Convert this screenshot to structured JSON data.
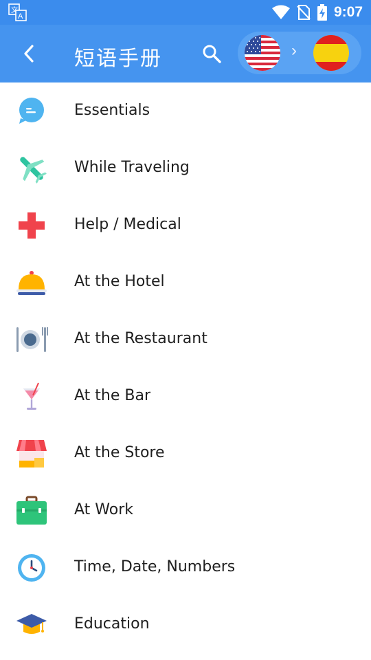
{
  "status_bar": {
    "time": "9:07",
    "icons": [
      "translate-icon",
      "wifi-icon",
      "no-sim-icon",
      "battery-charging-icon"
    ]
  },
  "app_bar": {
    "title": "短语手册",
    "back_icon": "back-arrow-icon",
    "search_icon": "search-icon",
    "source_language_flag": "us-flag",
    "target_language_flag": "spain-flag",
    "arrow": "›"
  },
  "categories": [
    {
      "label": "Essentials",
      "icon": "speech-bubble-icon"
    },
    {
      "label": "While Traveling",
      "icon": "airplane-icon"
    },
    {
      "label": "Help / Medical",
      "icon": "medical-cross-icon"
    },
    {
      "label": "At the Hotel",
      "icon": "hotel-bell-icon"
    },
    {
      "label": "At the Restaurant",
      "icon": "plate-cutlery-icon"
    },
    {
      "label": "At the Bar",
      "icon": "cocktail-icon"
    },
    {
      "label": "At the Store",
      "icon": "store-icon"
    },
    {
      "label": "At Work",
      "icon": "briefcase-icon"
    },
    {
      "label": "Time, Date, Numbers",
      "icon": "clock-icon"
    },
    {
      "label": "Education",
      "icon": "graduation-cap-icon"
    }
  ],
  "colors": {
    "status_bar": "#3b8ced",
    "app_bar": "#4594ef",
    "pill": "#5aa3f3"
  }
}
